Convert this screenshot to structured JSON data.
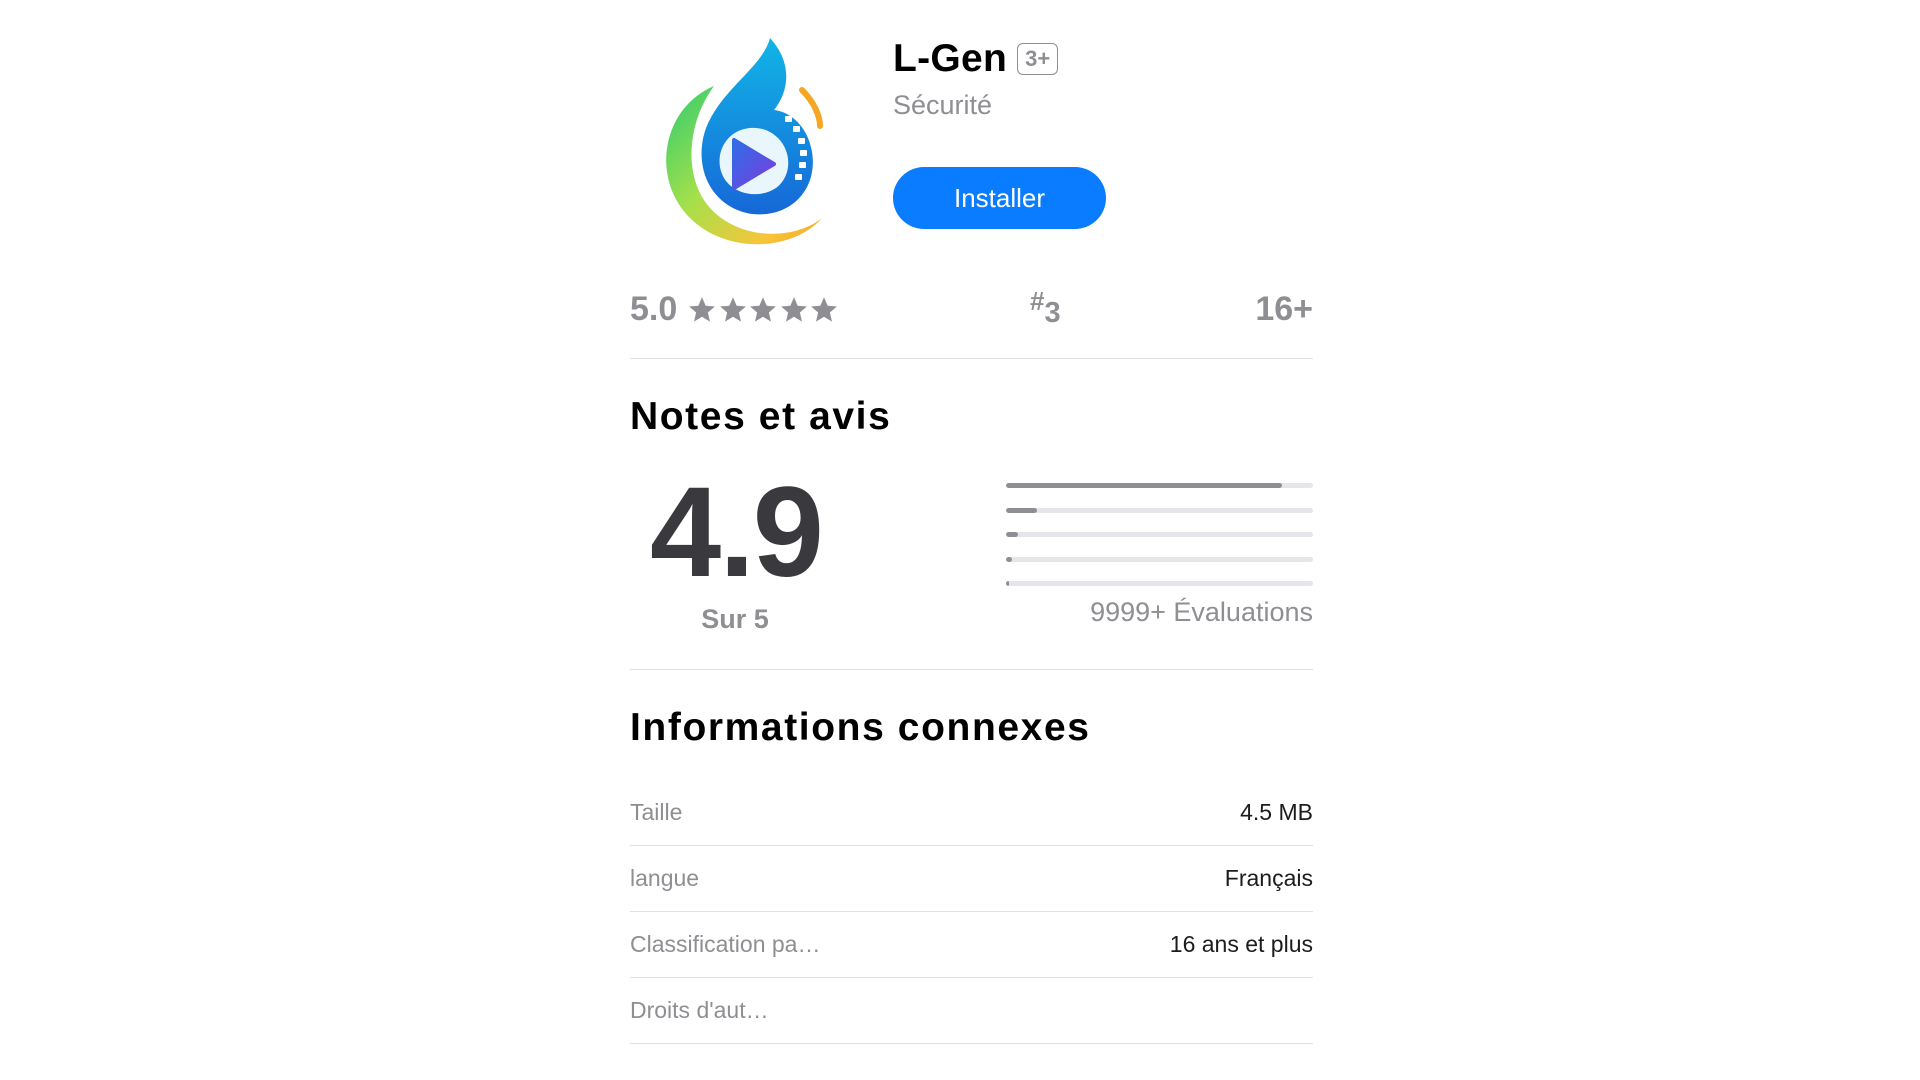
{
  "app": {
    "name": "L-Gen",
    "age_badge": "3+",
    "category": "Sécurité",
    "install_label": "Installer"
  },
  "stats": {
    "rating": "5.0",
    "star_count": 5,
    "rank_symbol": "#",
    "rank_value": "3",
    "age": "16+"
  },
  "ratings": {
    "title": "Notes et avis",
    "score": "4.9",
    "out_of": "Sur 5",
    "distribution": [
      0.9,
      0.1,
      0.04,
      0.02,
      0.01
    ],
    "count": "9999+ Évaluations"
  },
  "info": {
    "title": "Informations connexes",
    "rows": [
      {
        "label": "Taille",
        "value": "4.5 MB"
      },
      {
        "label": "langue",
        "value": "Français"
      },
      {
        "label": "Classification pa…",
        "value": "16 ans et plus"
      },
      {
        "label": "Droits d'aut…",
        "value": ""
      }
    ]
  },
  "colors": {
    "accent": "#0a7cff",
    "secondary_text": "#8e8e93",
    "divider": "#e0e0e5"
  },
  "icons": {
    "app_icon": "app-logo-icon",
    "star": "star-icon"
  }
}
